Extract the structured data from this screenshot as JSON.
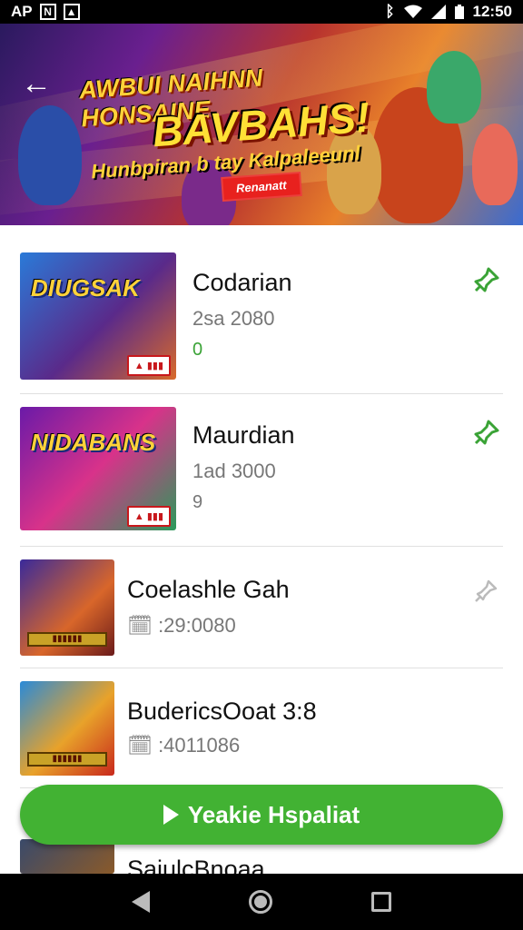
{
  "status_bar": {
    "carrier": "AP",
    "time": "12:50"
  },
  "banner": {
    "title_line1": "AWBUI NAIHNN HONSAINE",
    "title_line2": "BAVBAHS!",
    "subtitle": "Hunbpiran b tay Kalpaleeunl",
    "tag": "Renanatt"
  },
  "games": [
    {
      "thumb_text": "DIUGSAK",
      "title": "Codarian",
      "meta": "2sa 2080",
      "count": "0",
      "pinned": true
    },
    {
      "thumb_text": "NIDABANS",
      "title": "Maurdian",
      "meta": "1ad 3000",
      "count": "9",
      "pinned": true
    },
    {
      "thumb_text": "",
      "title": "Coelashle Gah",
      "meta": ":29:0080",
      "count": "",
      "pinned": false
    },
    {
      "thumb_text": "",
      "title": "BudericsOoat 3:8",
      "meta": ":4011086",
      "count": "",
      "pinned": false
    },
    {
      "thumb_text": "",
      "title": "SaiulcBnoaa",
      "meta": "",
      "count": "",
      "pinned": false
    }
  ],
  "fab": {
    "label": "Yeakie Hspaliat"
  },
  "colors": {
    "accent": "#42b233",
    "pin": "#3aa336"
  }
}
